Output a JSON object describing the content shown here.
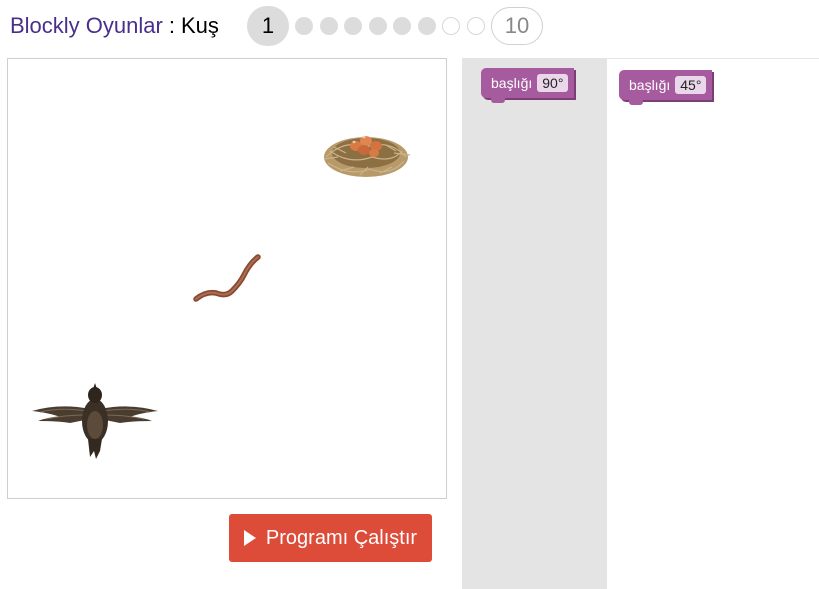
{
  "header": {
    "app_link": "Blockly Oyunlar",
    "separator": ":",
    "level_name": "Kuş"
  },
  "levels": {
    "current": "1",
    "last": "10",
    "dots_completed": 6,
    "dots_remaining": 2
  },
  "scene": {
    "sprites": [
      "nest-with-eggs",
      "worm",
      "bird"
    ]
  },
  "run_button": {
    "label": "Programı Çalıştır",
    "color": "#dd4b39"
  },
  "toolbox": {
    "blocks": [
      {
        "label": "başlığı",
        "value": "90°"
      }
    ]
  },
  "workspace": {
    "blocks": [
      {
        "label": "başlığı",
        "value": "45°"
      }
    ]
  },
  "colors": {
    "block": "#a55b9e",
    "link": "#4a2f8a"
  }
}
